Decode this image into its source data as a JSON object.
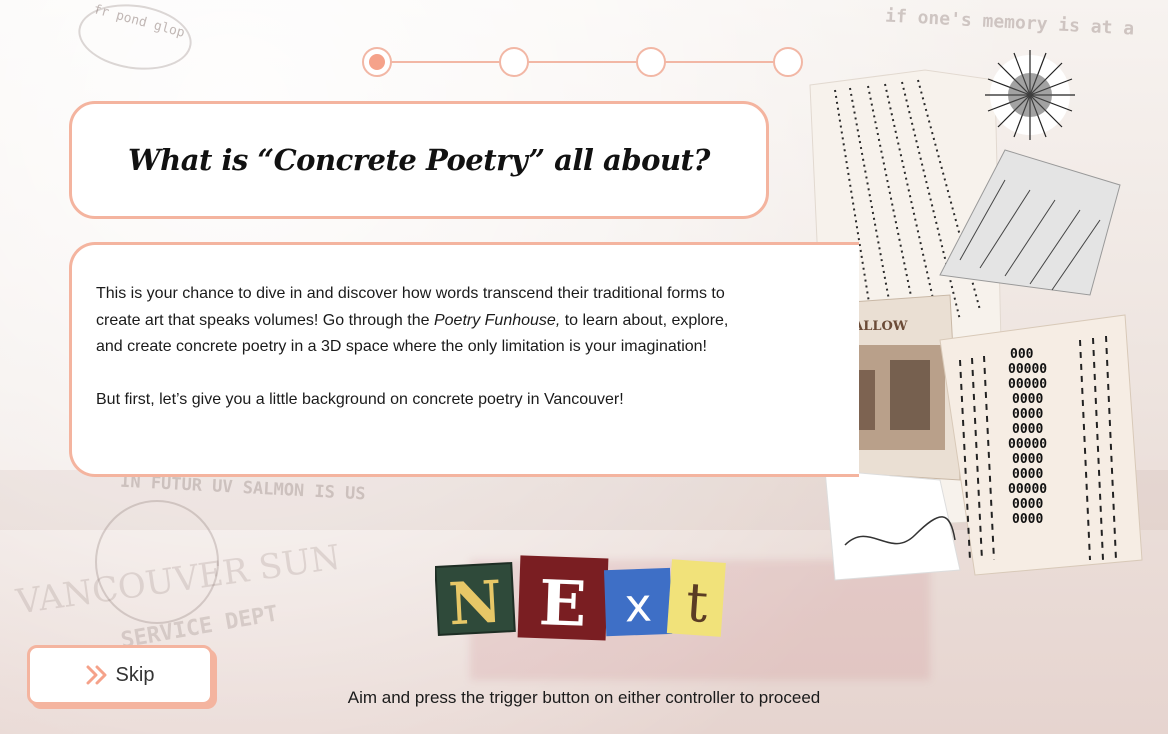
{
  "progress": {
    "total": 4,
    "current": 1
  },
  "title": "What is “Concrete Poetry” all about?",
  "body": {
    "p1_part1": "This is your chance to dive in and discover how words transcend their traditional forms to create art that speaks volumes! Go through the ",
    "p1_italic": "Poetry Funhouse,",
    "p1_part2": " to learn about, explore, and create concrete poetry in a 3D space where the only limitation is your imagination!",
    "p2": "But first, let’s give you a little background on concrete poetry in Vancouver!"
  },
  "next_button": {
    "letters": [
      "N",
      "E",
      "x",
      "t"
    ]
  },
  "skip_button": {
    "label": "Skip",
    "icon": "double-chevron-right-icon"
  },
  "hint": "Aim and press the trigger button on either controller to proceed",
  "background_text": {
    "top_right": "if one's memory is at a",
    "salmon": "IN FUTUR UV SALMON IS US",
    "sun": "VANCOUVER SUN",
    "dept": "SERVICE DEPT",
    "doodle": "fr pond glop"
  },
  "collage": {
    "photo_title": "SWALLOW THE RESIDENTS",
    "pattern": "000 00000 00000 0000 0000 0000 00000 0000 0000 00000 0000 0000 0000 0000"
  },
  "colors": {
    "accent": "#f4b49f",
    "accent_dark": "#f5a28a"
  }
}
